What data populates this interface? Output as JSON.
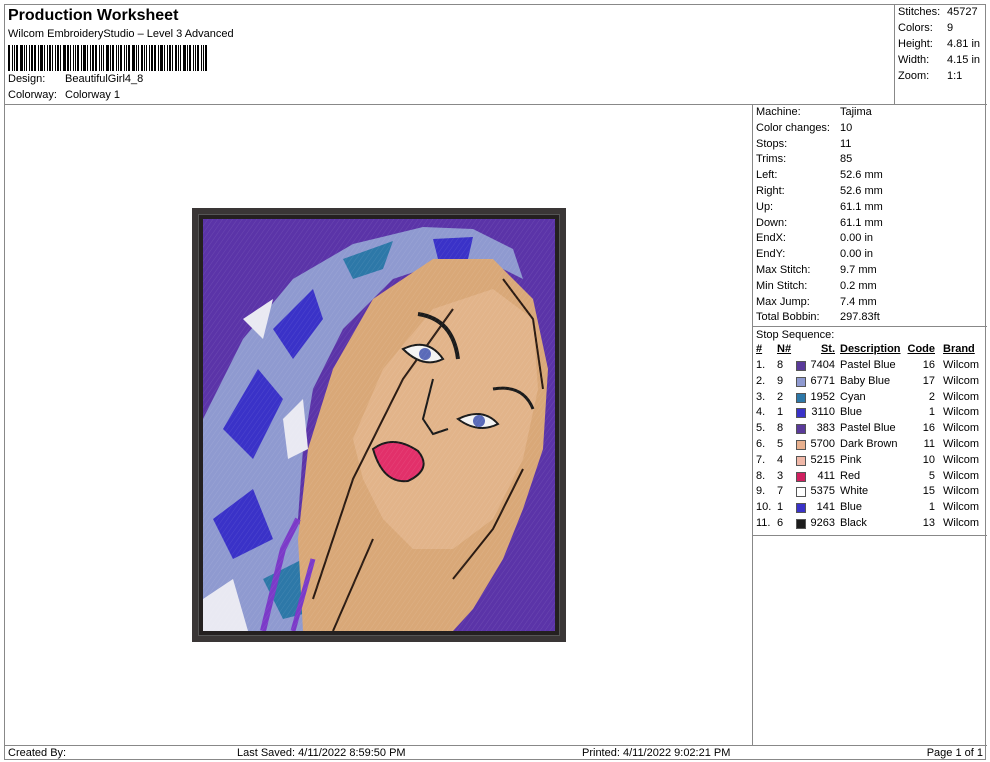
{
  "header": {
    "title": "Production Worksheet",
    "subtitle": "Wilcom EmbroideryStudio – Level 3 Advanced",
    "design_label": "Design:",
    "design_value": "BeautifulGirl4_8",
    "colorway_label": "Colorway:",
    "colorway_value": "Colorway 1"
  },
  "stats": [
    {
      "label": "Stitches:",
      "value": "45727"
    },
    {
      "label": "Colors:",
      "value": "9"
    },
    {
      "label": "Height:",
      "value": "4.81 in"
    },
    {
      "label": "Width:",
      "value": "4.15 in"
    },
    {
      "label": "Zoom:",
      "value": "1:1"
    }
  ],
  "machine_info": [
    {
      "label": "Machine:",
      "value": "Tajima"
    },
    {
      "label": "Color changes:",
      "value": "10"
    },
    {
      "label": "Stops:",
      "value": "11"
    },
    {
      "label": "Trims:",
      "value": "85"
    },
    {
      "label": "Left:",
      "value": "52.6 mm"
    },
    {
      "label": "Right:",
      "value": "52.6 mm"
    },
    {
      "label": "Up:",
      "value": "61.1 mm"
    },
    {
      "label": "Down:",
      "value": "61.1 mm"
    },
    {
      "label": "EndX:",
      "value": "0.00 in"
    },
    {
      "label": "EndY:",
      "value": "0.00 in"
    },
    {
      "label": "Max Stitch:",
      "value": "9.7 mm"
    },
    {
      "label": "Min Stitch:",
      "value": "0.2 mm"
    },
    {
      "label": "Max Jump:",
      "value": "7.4 mm"
    },
    {
      "label": "Total Bobbin:",
      "value": "297.83ft"
    }
  ],
  "stop_sequence": {
    "title": "Stop Sequence:",
    "headers": {
      "num": "#",
      "n": "N#",
      "st": "St.",
      "desc": "Description",
      "code": "Code",
      "brand": "Brand"
    },
    "rows": [
      {
        "num": "1.",
        "n": "8",
        "color": "#5a3a9a",
        "st": "7404",
        "desc": "Pastel Blue",
        "code": "16",
        "brand": "Wilcom"
      },
      {
        "num": "2.",
        "n": "9",
        "color": "#8f9ad0",
        "st": "6771",
        "desc": "Baby Blue",
        "code": "17",
        "brand": "Wilcom"
      },
      {
        "num": "3.",
        "n": "2",
        "color": "#2d78a8",
        "st": "1952",
        "desc": "Cyan",
        "code": "2",
        "brand": "Wilcom"
      },
      {
        "num": "4.",
        "n": "1",
        "color": "#3a32c8",
        "st": "3110",
        "desc": "Blue",
        "code": "1",
        "brand": "Wilcom"
      },
      {
        "num": "5.",
        "n": "8",
        "color": "#5a3a9a",
        "st": "383",
        "desc": "Pastel Blue",
        "code": "16",
        "brand": "Wilcom"
      },
      {
        "num": "6.",
        "n": "5",
        "color": "#e8b08e",
        "st": "5700",
        "desc": "Dark Brown",
        "code": "11",
        "brand": "Wilcom"
      },
      {
        "num": "7.",
        "n": "4",
        "color": "#f0b8a8",
        "st": "5215",
        "desc": "Pink",
        "code": "10",
        "brand": "Wilcom"
      },
      {
        "num": "8.",
        "n": "3",
        "color": "#d02060",
        "st": "411",
        "desc": "Red",
        "code": "5",
        "brand": "Wilcom"
      },
      {
        "num": "9.",
        "n": "7",
        "color": "#ffffff",
        "st": "5375",
        "desc": "White",
        "code": "15",
        "brand": "Wilcom"
      },
      {
        "num": "10.",
        "n": "1",
        "color": "#3a32c8",
        "st": "141",
        "desc": "Blue",
        "code": "1",
        "brand": "Wilcom"
      },
      {
        "num": "11.",
        "n": "6",
        "color": "#1c1c1c",
        "st": "9263",
        "desc": "Black",
        "code": "13",
        "brand": "Wilcom"
      }
    ]
  },
  "footer": {
    "created_by": "Created By:",
    "last_saved": "Last Saved: 4/11/2022 8:59:50 PM",
    "printed": "Printed: 4/11/2022 9:02:21 PM",
    "page": "Page 1 of 1"
  }
}
